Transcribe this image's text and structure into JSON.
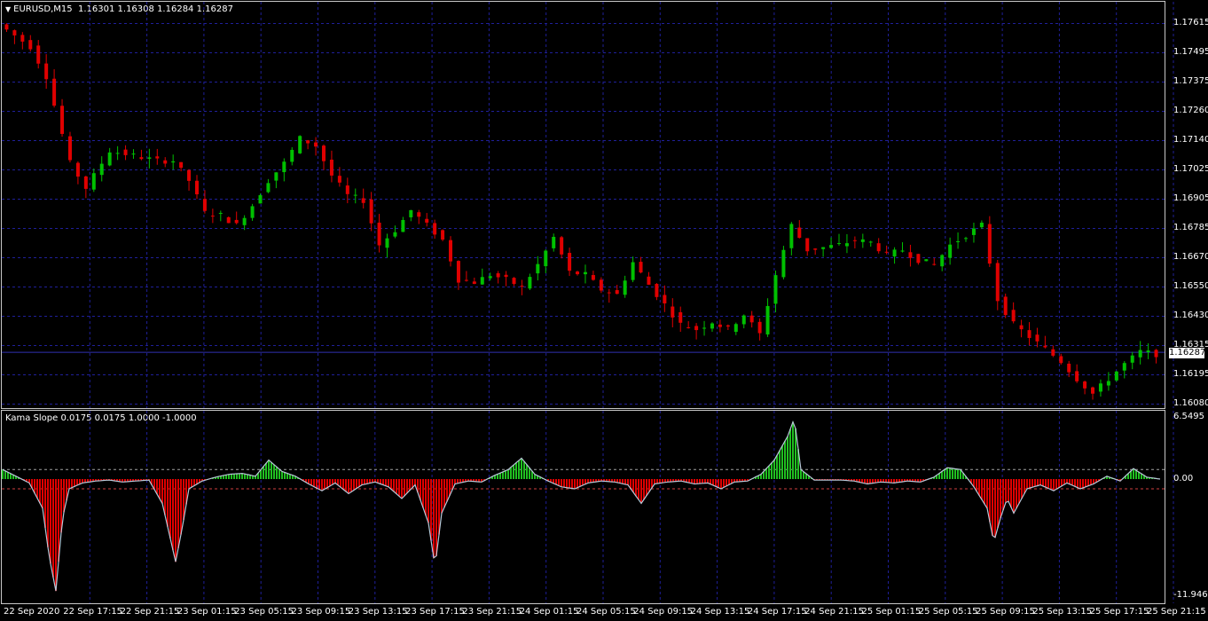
{
  "main_pane": {
    "symbol": "EURUSD,M15",
    "ohlc": "1.16301 1.16308 1.16284 1.16287"
  },
  "indicator_pane": {
    "title": "Kama Slope 0.0175 0.0175 1.0000 -1.0000"
  },
  "colors": {
    "background": "#000000",
    "grid": "#1f1f99",
    "bull_candle": "#00c000",
    "bear_candle": "#e00000",
    "histogram_up": "#20c020",
    "histogram_down": "#e00000",
    "slope_line": "#b8c8d8",
    "level_up": "#a0a0a0",
    "level_down": "#d04040",
    "price_line": "#3030b0"
  },
  "chart_data": [
    {
      "type": "candlestick",
      "title": "EURUSD,M15",
      "y_ticks": [
        "1.17615",
        "1.17495",
        "1.17375",
        "1.17260",
        "1.17140",
        "1.17025",
        "1.16905",
        "1.16785",
        "1.16670",
        "1.16550",
        "1.16430",
        "1.16315",
        "1.16195",
        "1.16080"
      ],
      "ylim": [
        1.1608,
        1.17615
      ],
      "current_price": "1.16287",
      "x_ticks": [
        "22 Sep 2020",
        "22 Sep 17:15",
        "22 Sep 21:15",
        "23 Sep 01:15",
        "23 Sep 05:15",
        "23 Sep 09:15",
        "23 Sep 13:15",
        "23 Sep 17:15",
        "23 Sep 21:15",
        "24 Sep 01:15",
        "24 Sep 05:15",
        "24 Sep 09:15",
        "24 Sep 13:15",
        "24 Sep 17:15",
        "24 Sep 21:15",
        "25 Sep 01:15",
        "25 Sep 05:15",
        "25 Sep 09:15",
        "25 Sep 13:15",
        "25 Sep 17:15",
        "25 Sep 21:15"
      ],
      "close_path": [
        [
          0,
          1.1761
        ],
        [
          4,
          1.1752
        ],
        [
          6,
          1.174
        ],
        [
          9,
          1.1705
        ],
        [
          11,
          1.1695
        ],
        [
          14,
          1.171
        ],
        [
          17,
          1.1708
        ],
        [
          20,
          1.1706
        ],
        [
          22,
          1.1706
        ],
        [
          24,
          1.1698
        ],
        [
          26,
          1.1685
        ],
        [
          28,
          1.1684
        ],
        [
          30,
          1.168
        ],
        [
          32,
          1.1688
        ],
        [
          34,
          1.1698
        ],
        [
          36,
          1.1705
        ],
        [
          38,
          1.1715
        ],
        [
          40,
          1.1712
        ],
        [
          42,
          1.17
        ],
        [
          44,
          1.1692
        ],
        [
          46,
          1.169
        ],
        [
          48,
          1.1672
        ],
        [
          50,
          1.1678
        ],
        [
          52,
          1.1686
        ],
        [
          54,
          1.168
        ],
        [
          56,
          1.1674
        ],
        [
          58,
          1.1658
        ],
        [
          60,
          1.1657
        ],
        [
          62,
          1.166
        ],
        [
          64,
          1.1658
        ],
        [
          66,
          1.1655
        ],
        [
          68,
          1.1664
        ],
        [
          70,
          1.1675
        ],
        [
          72,
          1.1661
        ],
        [
          74,
          1.166
        ],
        [
          76,
          1.1654
        ],
        [
          78,
          1.1652
        ],
        [
          80,
          1.1665
        ],
        [
          82,
          1.1656
        ],
        [
          84,
          1.1648
        ],
        [
          86,
          1.164
        ],
        [
          88,
          1.1638
        ],
        [
          90,
          1.1641
        ],
        [
          92,
          1.1638
        ],
        [
          94,
          1.1644
        ],
        [
          96,
          1.1636
        ],
        [
          98,
          1.166
        ],
        [
          100,
          1.168
        ],
        [
          102,
          1.167
        ],
        [
          104,
          1.1671
        ],
        [
          106,
          1.1672
        ],
        [
          108,
          1.1674
        ],
        [
          110,
          1.1673
        ],
        [
          112,
          1.1668
        ],
        [
          114,
          1.167
        ],
        [
          116,
          1.1666
        ],
        [
          118,
          1.1664
        ],
        [
          120,
          1.1672
        ],
        [
          122,
          1.1676
        ],
        [
          124,
          1.168
        ],
        [
          126,
          1.165
        ],
        [
          128,
          1.164
        ],
        [
          130,
          1.1635
        ],
        [
          132,
          1.163
        ],
        [
          134,
          1.1625
        ],
        [
          136,
          1.1618
        ],
        [
          138,
          1.1612
        ],
        [
          140,
          1.1618
        ],
        [
          142,
          1.1624
        ],
        [
          144,
          1.1629
        ],
        [
          146,
          1.1628
        ]
      ]
    },
    {
      "type": "histogram",
      "title": "Kama Slope 0.0175 0.0175 1.0000 -1.0000",
      "y_ticks": [
        "6.5495",
        "0.00",
        "-11.946"
      ],
      "ylim": [
        -11.946,
        6.5495
      ],
      "levels": [
        1.0,
        -1.0
      ],
      "samples": [
        [
          0,
          1.0
        ],
        [
          2,
          0.3
        ],
        [
          4,
          -0.4
        ],
        [
          6,
          -3.0
        ],
        [
          7,
          -8.0
        ],
        [
          8,
          -11.5
        ],
        [
          9,
          -4.0
        ],
        [
          10,
          -1.0
        ],
        [
          12,
          -0.4
        ],
        [
          14,
          -0.2
        ],
        [
          16,
          -0.1
        ],
        [
          18,
          -0.3
        ],
        [
          20,
          -0.2
        ],
        [
          22,
          -0.1
        ],
        [
          24,
          -2.5
        ],
        [
          26,
          -8.5
        ],
        [
          27,
          -5.0
        ],
        [
          28,
          -1.0
        ],
        [
          30,
          -0.2
        ],
        [
          32,
          0.2
        ],
        [
          34,
          0.5
        ],
        [
          36,
          0.6
        ],
        [
          38,
          0.3
        ],
        [
          40,
          2.0
        ],
        [
          42,
          0.8
        ],
        [
          44,
          0.3
        ],
        [
          46,
          -0.5
        ],
        [
          48,
          -1.2
        ],
        [
          50,
          -0.4
        ],
        [
          52,
          -1.5
        ],
        [
          54,
          -0.6
        ],
        [
          56,
          -0.3
        ],
        [
          58,
          -0.8
        ],
        [
          60,
          -2.0
        ],
        [
          62,
          -0.6
        ],
        [
          64,
          -4.5
        ],
        [
          65,
          -9.0
        ],
        [
          66,
          -3.5
        ],
        [
          68,
          -0.5
        ],
        [
          70,
          -0.2
        ],
        [
          72,
          -0.3
        ],
        [
          74,
          0.4
        ],
        [
          76,
          1.0
        ],
        [
          78,
          2.2
        ],
        [
          80,
          0.5
        ],
        [
          82,
          -0.2
        ],
        [
          84,
          -0.8
        ],
        [
          86,
          -1.0
        ],
        [
          88,
          -0.4
        ],
        [
          90,
          -0.2
        ],
        [
          92,
          -0.3
        ],
        [
          94,
          -0.6
        ],
        [
          96,
          -2.5
        ],
        [
          98,
          -0.5
        ],
        [
          100,
          -0.3
        ],
        [
          102,
          -0.2
        ],
        [
          104,
          -0.5
        ],
        [
          106,
          -0.4
        ],
        [
          108,
          -1.0
        ],
        [
          110,
          -0.3
        ],
        [
          112,
          -0.2
        ],
        [
          114,
          0.5
        ],
        [
          116,
          2.0
        ],
        [
          118,
          4.5
        ],
        [
          119,
          6.4
        ],
        [
          120,
          1.0
        ],
        [
          122,
          -0.1
        ],
        [
          124,
          -0.1
        ],
        [
          126,
          -0.1
        ],
        [
          128,
          -0.2
        ],
        [
          130,
          -0.5
        ],
        [
          132,
          -0.3
        ],
        [
          134,
          -0.4
        ],
        [
          136,
          -0.2
        ],
        [
          138,
          -0.3
        ],
        [
          140,
          0.2
        ],
        [
          142,
          1.2
        ],
        [
          144,
          1.0
        ],
        [
          146,
          -0.8
        ],
        [
          148,
          -3.0
        ],
        [
          149,
          -6.5
        ],
        [
          150,
          -4.0
        ],
        [
          151,
          -2.0
        ],
        [
          152,
          -3.5
        ],
        [
          154,
          -1.0
        ],
        [
          156,
          -0.6
        ],
        [
          158,
          -1.2
        ],
        [
          160,
          -0.4
        ],
        [
          162,
          -1.0
        ],
        [
          164,
          -0.5
        ],
        [
          166,
          0.3
        ],
        [
          168,
          -0.2
        ],
        [
          170,
          1.1
        ],
        [
          172,
          0.2
        ],
        [
          174,
          0.0
        ]
      ]
    }
  ]
}
